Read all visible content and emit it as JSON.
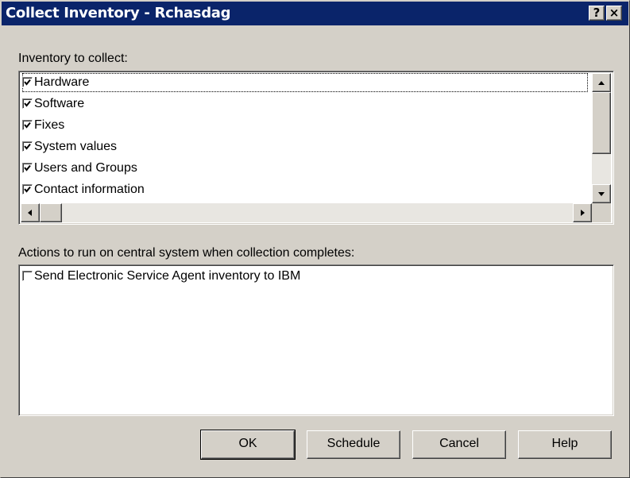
{
  "window": {
    "title": "Collect Inventory - Rchasdag",
    "help_button": "?",
    "close_button": "×"
  },
  "inventory": {
    "label": "Inventory to collect:",
    "items": [
      {
        "label": "Hardware",
        "checked": true
      },
      {
        "label": "Software",
        "checked": true
      },
      {
        "label": "Fixes",
        "checked": true
      },
      {
        "label": "System values",
        "checked": true
      },
      {
        "label": "Users and Groups",
        "checked": true
      },
      {
        "label": "Contact information",
        "checked": true
      }
    ]
  },
  "actions": {
    "label": "Actions to run on central system when collection completes:",
    "items": [
      {
        "label": "Send Electronic Service Agent inventory to IBM",
        "checked": false
      }
    ]
  },
  "buttons": {
    "ok": "OK",
    "schedule": "Schedule",
    "cancel": "Cancel",
    "help": "Help"
  },
  "icons": {
    "help": "question-mark-icon",
    "close": "close-icon",
    "scroll_up": "arrow-up-icon",
    "scroll_down": "arrow-down-icon",
    "scroll_left": "arrow-left-icon",
    "scroll_right": "arrow-right-icon",
    "check": "checkmark-icon"
  }
}
